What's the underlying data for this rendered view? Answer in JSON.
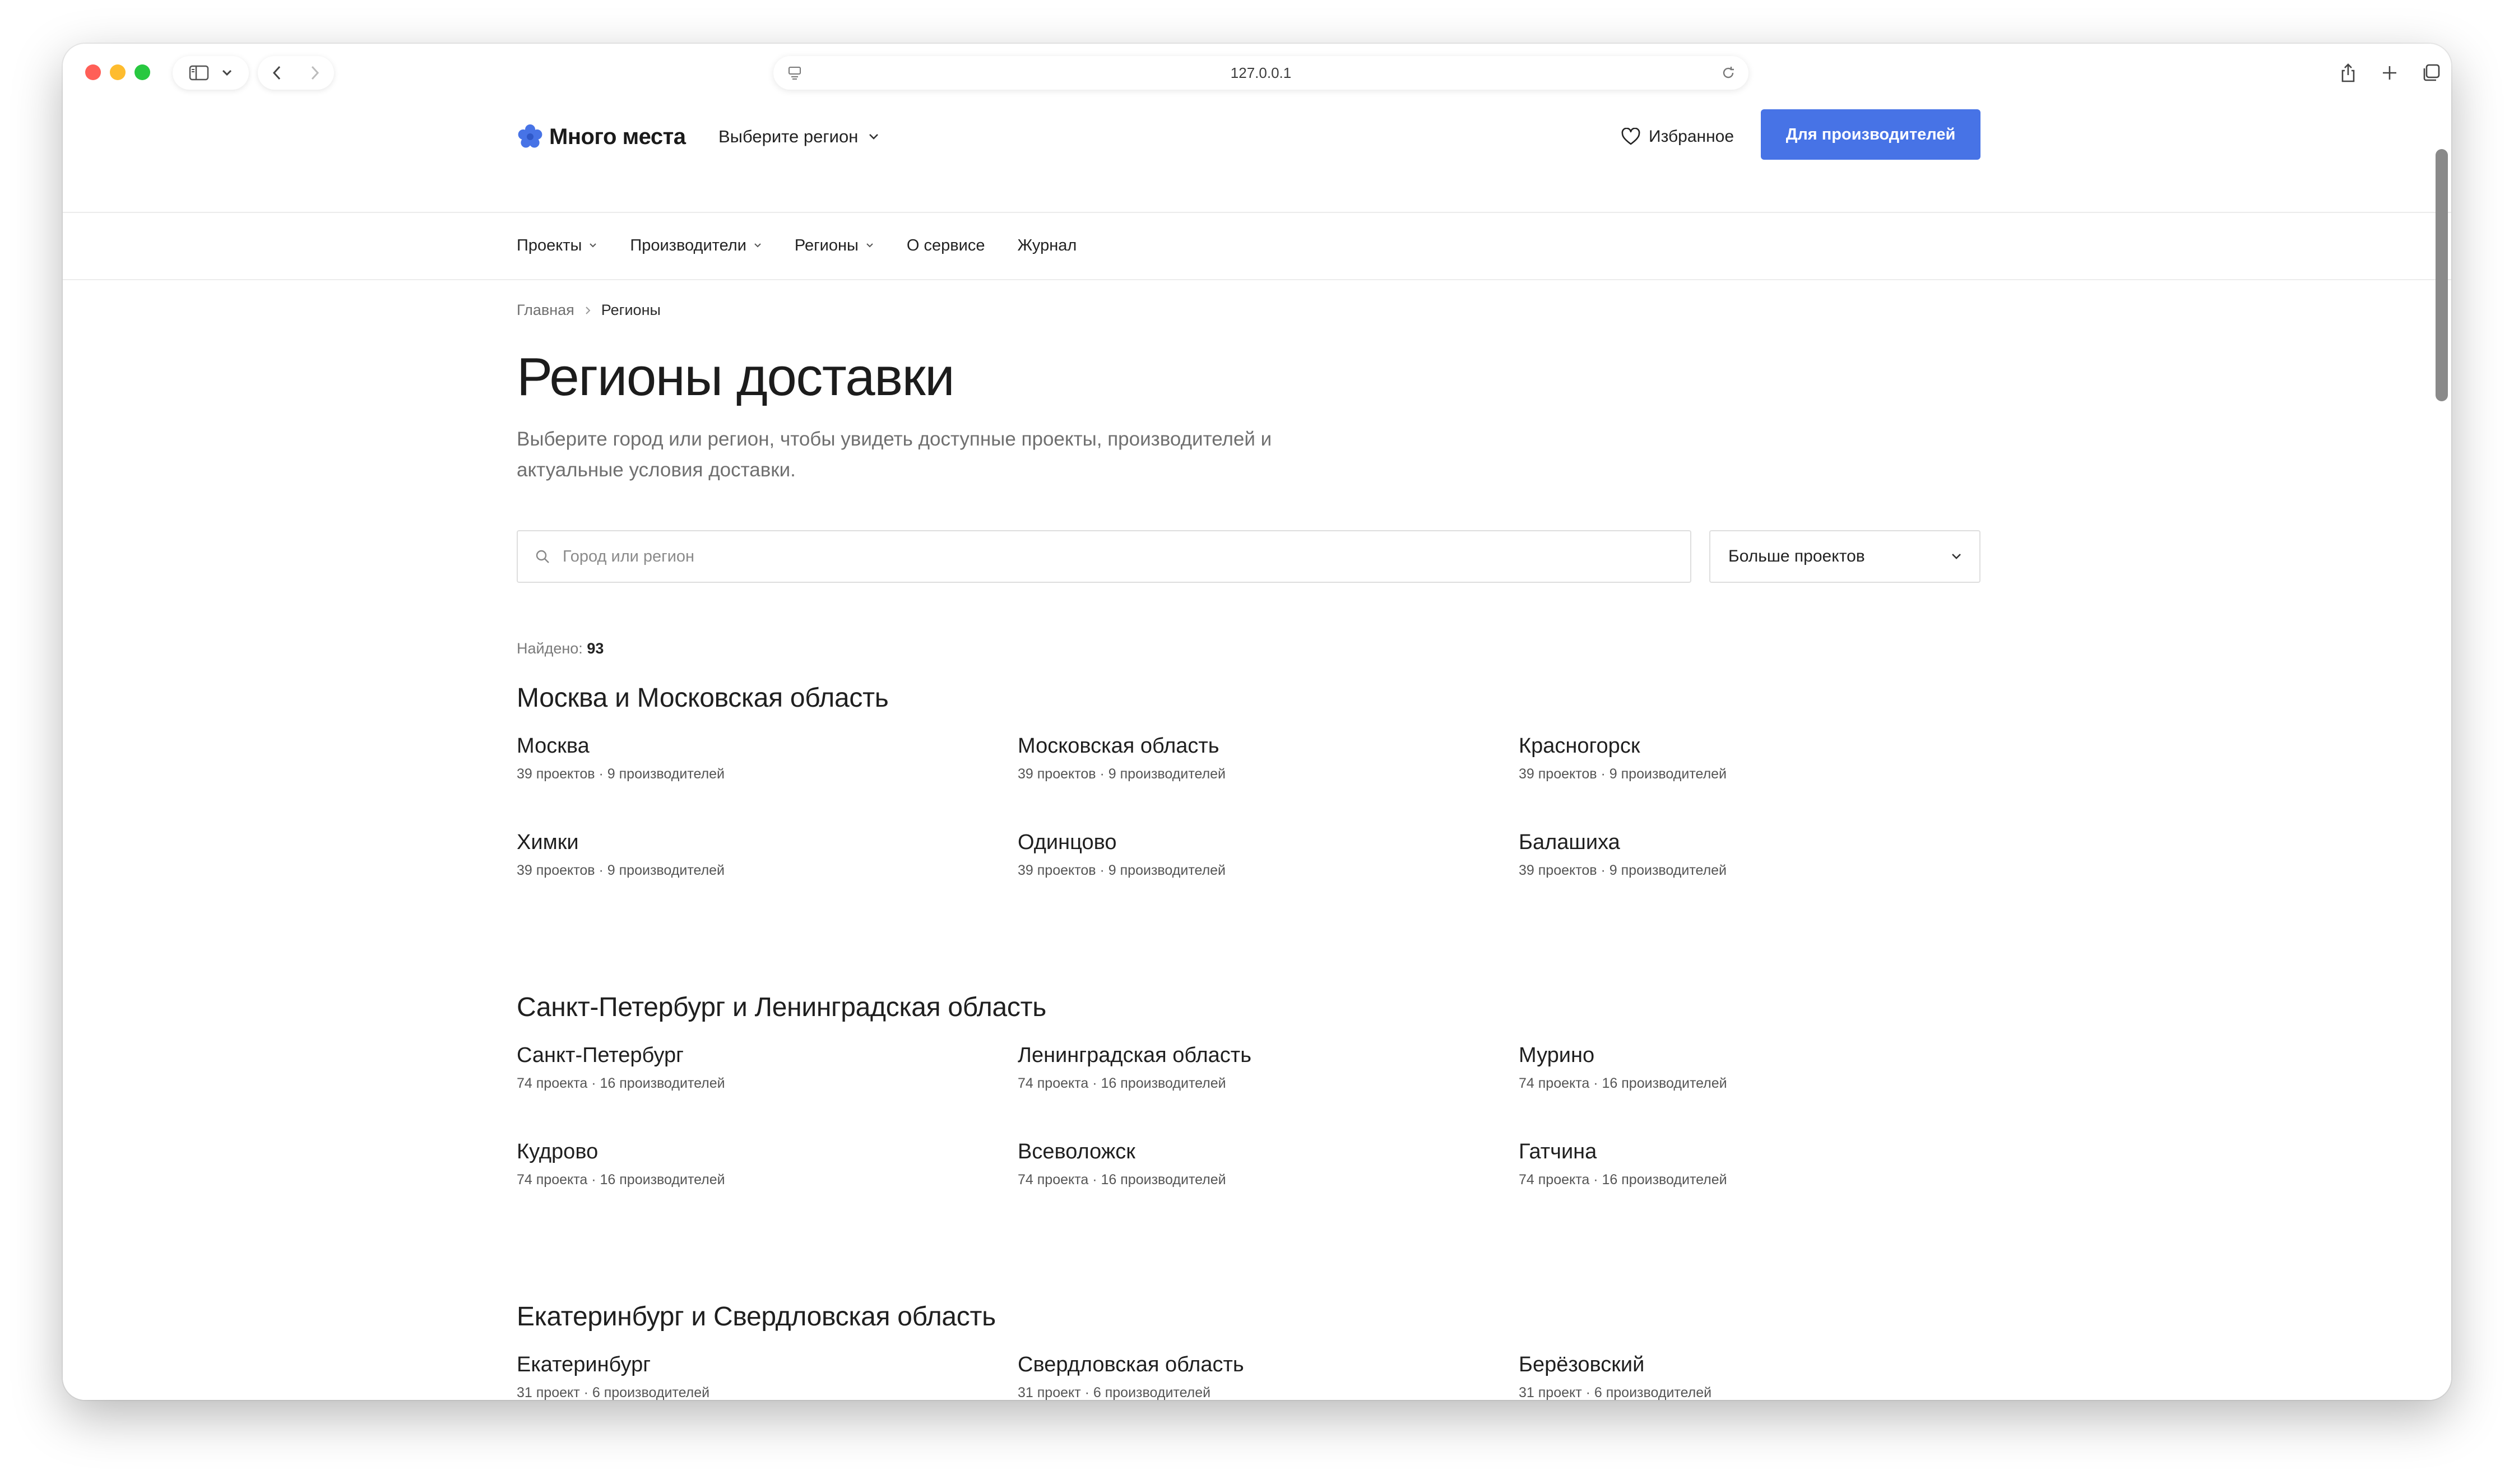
{
  "browser": {
    "url": "127.0.0.1"
  },
  "header": {
    "logo_text": "Много места",
    "region_select": "Выберите регион",
    "favorites": "Избранное",
    "cta": "Для производителей",
    "brand_color": "#4773e6"
  },
  "nav": {
    "items": [
      {
        "label": "Проекты",
        "dropdown": true
      },
      {
        "label": "Производители",
        "dropdown": true
      },
      {
        "label": "Регионы",
        "dropdown": true
      },
      {
        "label": "О сервисе",
        "dropdown": false
      },
      {
        "label": "Журнал",
        "dropdown": false
      }
    ]
  },
  "breadcrumb": {
    "home": "Главная",
    "current": "Регионы"
  },
  "page": {
    "title": "Регионы доставки",
    "description_line1": "Выберите город или регион, чтобы увидеть доступные проекты, производителей и",
    "description_line2": "актуальные условия доставки."
  },
  "search": {
    "placeholder": "Город или регион",
    "value": ""
  },
  "sort": {
    "selected": "Больше проектов"
  },
  "results": {
    "label": "Найдено:",
    "count": "93"
  },
  "groups": [
    {
      "title": "Москва и Московская область",
      "regions": [
        {
          "name": "Москва",
          "meta": "39 проектов · 9 производителей"
        },
        {
          "name": "Московская область",
          "meta": "39 проектов · 9 производителей"
        },
        {
          "name": "Красногорск",
          "meta": "39 проектов · 9 производителей"
        },
        {
          "name": "Химки",
          "meta": "39 проектов · 9 производителей"
        },
        {
          "name": "Одинцово",
          "meta": "39 проектов · 9 производителей"
        },
        {
          "name": "Балашиха",
          "meta": "39 проектов · 9 производителей"
        }
      ]
    },
    {
      "title": "Санкт-Петербург и Ленинградская область",
      "regions": [
        {
          "name": "Санкт-Петербург",
          "meta": "74 проекта · 16 производителей"
        },
        {
          "name": "Ленинградская область",
          "meta": "74 проекта · 16 производителей"
        },
        {
          "name": "Мурино",
          "meta": "74 проекта · 16 производителей"
        },
        {
          "name": "Кудрово",
          "meta": "74 проекта · 16 производителей"
        },
        {
          "name": "Всеволожск",
          "meta": "74 проекта · 16 производителей"
        },
        {
          "name": "Гатчина",
          "meta": "74 проекта · 16 производителей"
        }
      ]
    },
    {
      "title": "Екатеринбург и Свердловская область",
      "regions": [
        {
          "name": "Екатеринбург",
          "meta": "31 проект · 6 производителей"
        },
        {
          "name": "Свердловская область",
          "meta": "31 проект · 6 производителей"
        },
        {
          "name": "Берёзовский",
          "meta": "31 проект · 6 производителей"
        }
      ]
    }
  ]
}
